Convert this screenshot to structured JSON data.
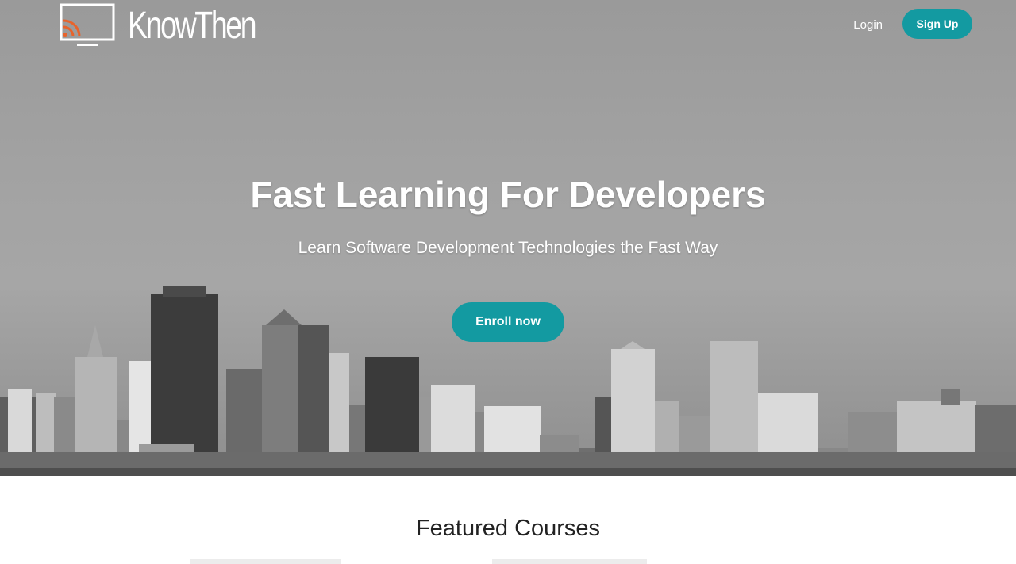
{
  "brand": {
    "name": "KnowThen",
    "logo_icon": "monitor-rss-icon",
    "accent_color": "#e8632b"
  },
  "nav": {
    "login_label": "Login",
    "signup_label": "Sign Up"
  },
  "hero": {
    "title": "Fast Learning For Developers",
    "subtitle": "Learn Software Development Technologies the Fast Way",
    "cta_label": "Enroll now",
    "background": "city-skyline-grayscale"
  },
  "featured": {
    "title": "Featured Courses"
  },
  "colors": {
    "primary": "#139aa1",
    "text_dark": "#222222"
  }
}
